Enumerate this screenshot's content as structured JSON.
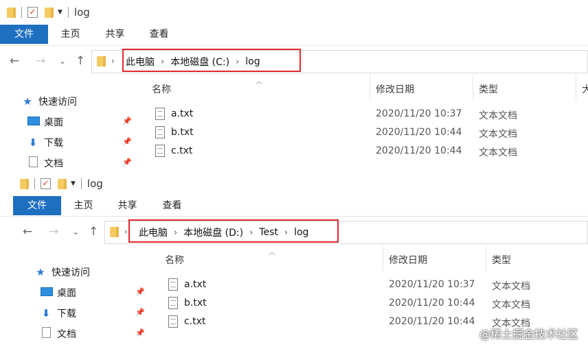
{
  "windows": [
    {
      "qa_title": "log",
      "ribbon_tabs": [
        "文件",
        "主页",
        "共享",
        "查看"
      ],
      "breadcrumbs": [
        "此电脑",
        "本地磁盘 (C:)",
        "log"
      ],
      "nav_items": [
        "快速访问",
        "桌面",
        "下载",
        "文档"
      ],
      "columns": [
        "名称",
        "修改日期",
        "类型",
        "大"
      ],
      "files": [
        {
          "name": "a.txt",
          "date": "2020/11/20 10:37",
          "type": "文本文档"
        },
        {
          "name": "b.txt",
          "date": "2020/11/20 10:44",
          "type": "文本文档"
        },
        {
          "name": "c.txt",
          "date": "2020/11/20 10:44",
          "type": "文本文档"
        }
      ]
    },
    {
      "qa_title": "log",
      "ribbon_tabs": [
        "文件",
        "主页",
        "共享",
        "查看"
      ],
      "breadcrumbs": [
        "此电脑",
        "本地磁盘 (D:)",
        "Test",
        "log"
      ],
      "nav_items": [
        "快速访问",
        "桌面",
        "下载",
        "文档"
      ],
      "columns": [
        "名称",
        "修改日期",
        "类型"
      ],
      "files": [
        {
          "name": "a.txt",
          "date": "2020/11/20 10:37",
          "type": "文本文档"
        },
        {
          "name": "b.txt",
          "date": "2020/11/20 10:44",
          "type": "文本文档"
        },
        {
          "name": "c.txt",
          "date": "2020/11/20 10:44",
          "type": "文本文档"
        }
      ]
    }
  ],
  "watermark": "@稀土掘金技术社区",
  "colors": {
    "file_tab": "#1f6fc1",
    "highlight_box": "#e0282e"
  }
}
